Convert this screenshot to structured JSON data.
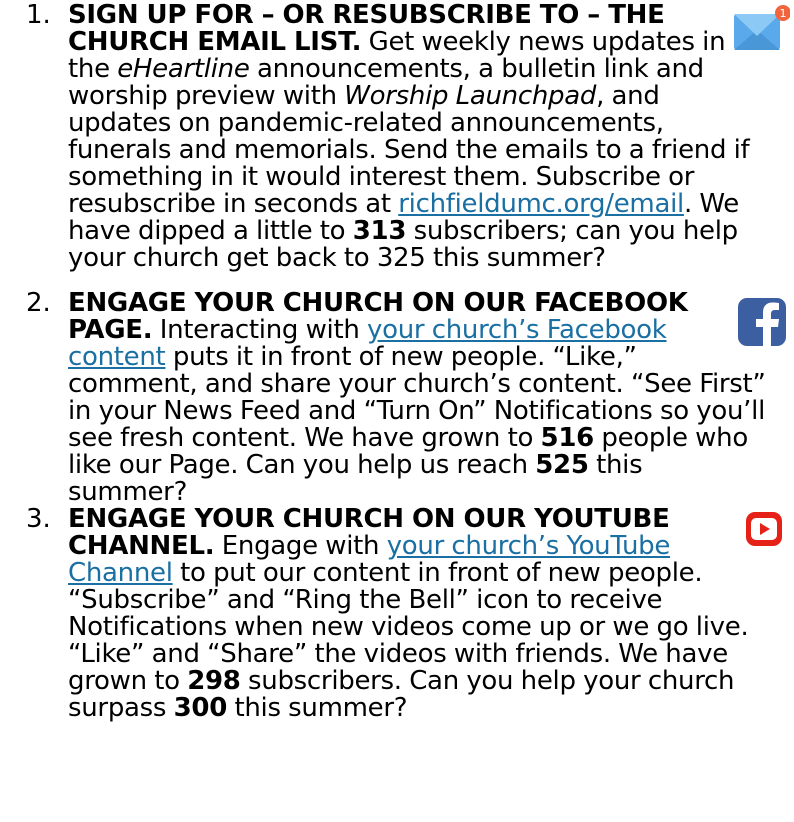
{
  "items": [
    {
      "number": "1.",
      "title": "SIGN UP FOR – OR RESUBSCRIBE TO – THE CHURCH EMAIL LIST.",
      "t1": " Get weekly news updates in the ",
      "i1": "eHeartline",
      "t2": " announcements, a bulletin link and worship preview with ",
      "i2": "Worship Launchpad",
      "t3": ", and updates on pandemic-related announcements, funerals and memorials. Send the emails to a friend if something in it would interest them. Subscribe or resubscribe in seconds at ",
      "link": "richfieldumc.org/email",
      "t4": ". We have dipped a little to ",
      "n1": "313",
      "t5": " subscribers; can you help your church get back to 325 this summer?",
      "icon": "email-icon",
      "badge": "1"
    },
    {
      "number": "2.",
      "title": "ENGAGE YOUR CHURCH ON OUR FACEBOOK PAGE.",
      "t1": " Interacting with ",
      "link": "your church’s Facebook content",
      "t2": " puts it in front of new people. “Like,” comment, and share your church’s content. “See First” in your News Feed and “Turn On” Notifications so you’ll see fresh content. We have grown to ",
      "n1": "516",
      "t3": " people who like our Page. Can you help us reach ",
      "n2": "525",
      "t4": " this summer?",
      "icon": "facebook-icon"
    },
    {
      "number": "3.",
      "title": "ENGAGE YOUR CHURCH ON OUR YOUTUBE CHANNEL.",
      "t1": " Engage with ",
      "link": "your church’s YouTube Channel",
      "t2": " to put our content in front of new people. “Subscribe” and “Ring the Bell” icon to receive Notifications when new videos come up or we go live. “Like” and “Share” the videos with friends. We have grown to ",
      "n1": "298",
      "t3": " subscribers. Can you help your church surpass ",
      "n2": "300",
      "t4": " this summer?",
      "icon": "youtube-icon"
    }
  ],
  "colors": {
    "link": "#1a6fa3",
    "email_icon": "#5aa9ea",
    "badge": "#f0653e",
    "facebook": "#3b5fa0",
    "youtube": "#e62117"
  }
}
